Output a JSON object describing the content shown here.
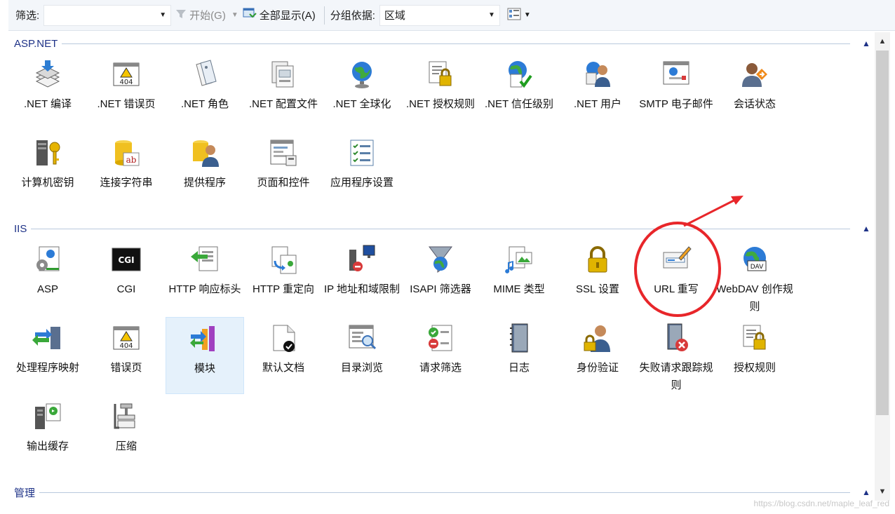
{
  "toolbar": {
    "filter_label": "筛选:",
    "filter_value": "",
    "start_label": "开始(G)",
    "show_all_label": "全部显示(A)",
    "group_by_label": "分组依据:",
    "group_by_value": "区域"
  },
  "groups": {
    "aspnet": {
      "title": "ASP.NET",
      "items": [
        {
          "label": ".NET 编译",
          "icon": "net-compile-icon"
        },
        {
          "label": ".NET 错误页",
          "icon": "net-error-page-icon",
          "icon_text": "404"
        },
        {
          "label": ".NET 角色",
          "icon": "net-roles-icon"
        },
        {
          "label": ".NET 配置文件",
          "icon": "net-profile-icon"
        },
        {
          "label": ".NET 全球化",
          "icon": "net-globalization-icon"
        },
        {
          "label": ".NET 授权规则",
          "icon": "net-authorization-icon"
        },
        {
          "label": ".NET 信任级别",
          "icon": "net-trust-level-icon"
        },
        {
          "label": ".NET 用户",
          "icon": "net-users-icon"
        },
        {
          "label": "SMTP 电子邮件",
          "icon": "smtp-email-icon"
        },
        {
          "label": "会话状态",
          "icon": "session-state-icon"
        },
        {
          "label": "计算机密钥",
          "icon": "machine-key-icon"
        },
        {
          "label": "连接字符串",
          "icon": "connection-strings-icon",
          "icon_text": "ab"
        },
        {
          "label": "提供程序",
          "icon": "providers-icon"
        },
        {
          "label": "页面和控件",
          "icon": "pages-controls-icon"
        },
        {
          "label": "应用程序设置",
          "icon": "app-settings-icon"
        }
      ]
    },
    "iis": {
      "title": "IIS",
      "items": [
        {
          "label": "ASP",
          "icon": "asp-icon"
        },
        {
          "label": "CGI",
          "icon": "cgi-icon",
          "icon_text": "CGI"
        },
        {
          "label": "HTTP 响应标头",
          "icon": "http-response-headers-icon"
        },
        {
          "label": "HTTP 重定向",
          "icon": "http-redirect-icon"
        },
        {
          "label": "IP 地址和域限制",
          "icon": "ip-domain-restrictions-icon"
        },
        {
          "label": "ISAPI 筛选器",
          "icon": "isapi-filters-icon"
        },
        {
          "label": "MIME 类型",
          "icon": "mime-types-icon"
        },
        {
          "label": "SSL 设置",
          "icon": "ssl-settings-icon"
        },
        {
          "label": "URL 重写",
          "icon": "url-rewrite-icon"
        },
        {
          "label": "WebDAV 创作规则",
          "icon": "webdav-icon",
          "icon_text": "DAV"
        },
        {
          "label": "处理程序映射",
          "icon": "handler-mappings-icon"
        },
        {
          "label": "错误页",
          "icon": "error-pages-icon",
          "icon_text": "404"
        },
        {
          "label": "模块",
          "icon": "modules-icon"
        },
        {
          "label": "默认文档",
          "icon": "default-document-icon"
        },
        {
          "label": "目录浏览",
          "icon": "directory-browsing-icon"
        },
        {
          "label": "请求筛选",
          "icon": "request-filtering-icon"
        },
        {
          "label": "日志",
          "icon": "logging-icon"
        },
        {
          "label": "身份验证",
          "icon": "authentication-icon"
        },
        {
          "label": "失败请求跟踪规则",
          "icon": "failed-request-tracing-icon"
        },
        {
          "label": "授权规则",
          "icon": "authorization-rules-icon"
        },
        {
          "label": "输出缓存",
          "icon": "output-caching-icon"
        },
        {
          "label": "压缩",
          "icon": "compression-icon"
        }
      ]
    },
    "management": {
      "title": "管理"
    }
  },
  "selected_item": "模块",
  "highlighted_item": "URL 重写",
  "watermark": "https://blog.csdn.net/maple_leaf_red",
  "colors": {
    "group_title": "#1e3287",
    "annotation": "#e8262a",
    "selection": "#e5f1fb"
  }
}
